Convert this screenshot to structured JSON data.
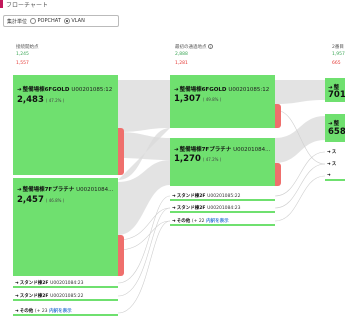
{
  "header": {
    "caption": "フローチャート",
    "selector_label": "集計単位",
    "options": [
      {
        "label": "POPCHAT",
        "checked": false
      },
      {
        "label": "VLAN",
        "checked": true
      }
    ]
  },
  "columns": [
    {
      "heading": "接続開始点",
      "total_in": "1,245",
      "total_drop": "1,557"
    },
    {
      "heading": "最初の通過地点",
      "total_in": "2,888",
      "total_drop": "1,281"
    },
    {
      "heading": "2番目",
      "total_in": "1,957",
      "total_drop": "665"
    }
  ],
  "nodes": {
    "c1_a": {
      "title": "整備場棟6FGOLD",
      "code": "U00201085:12",
      "count": "2,483",
      "pct": "( 47.2% )"
    },
    "c1_b": {
      "title": "整備場棟7Fプラチナ",
      "code": "U00201084...",
      "count": "2,457",
      "pct": "( 46.8% )"
    },
    "c2_a": {
      "title": "整備場棟6FGOLD",
      "code": "U00201085:12",
      "count": "1,307",
      "pct": "( 49.8% )"
    },
    "c2_b": {
      "title": "整備場棟7Fプラチナ",
      "code": "U00201084...",
      "count": "1,270",
      "pct": "( 47.2% )"
    },
    "c3_a": {
      "title": "整",
      "count": "701"
    },
    "c3_b": {
      "title": "整",
      "count": "658"
    }
  },
  "small_rows": {
    "c1": [
      {
        "title": "スタンド棟2F",
        "code": "U00201084:23"
      },
      {
        "title": "スタンド棟2F",
        "code": "U00201085:22"
      },
      {
        "title": "その他",
        "code": "(+ 23",
        "link": "内訳を表示"
      }
    ],
    "c2": [
      {
        "title": "スタンド棟2F",
        "code": "U00201085:22"
      },
      {
        "title": "スタンド棟2F",
        "code": "U00201084:23"
      },
      {
        "title": "その他",
        "code": "(+ 22",
        "link": "内訳を表示"
      }
    ],
    "c3": [
      {
        "title": "ス"
      },
      {
        "title": "ス"
      },
      {
        "title": ""
      }
    ]
  },
  "colors": {
    "node_green": "#6fe06f",
    "drop_red": "#ef6f6c",
    "flow_gray": "#d9d9d9",
    "accent": "#c2185b",
    "link_blue": "#3a7bd5"
  }
}
